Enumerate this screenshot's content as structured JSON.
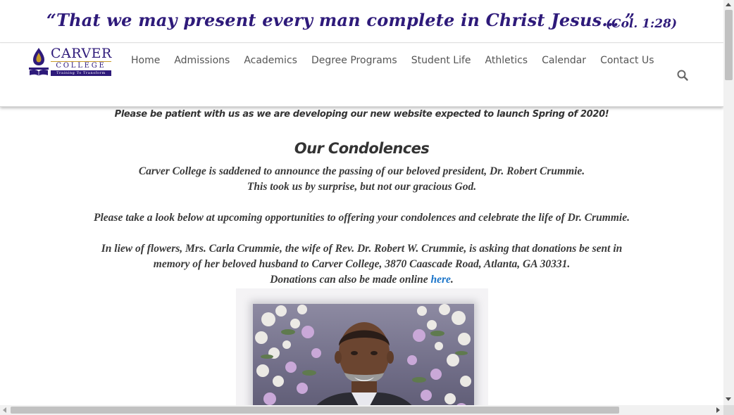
{
  "banner": {
    "quote": "“That we may present every man  complete in Christ Jesus… ”",
    "reference": "(Col. 1:28)"
  },
  "logo": {
    "name": "CARVER",
    "subtitle": "COLLEGE",
    "tagline": "Training To Transform"
  },
  "nav": {
    "items": [
      {
        "label": "Home"
      },
      {
        "label": "Admissions"
      },
      {
        "label": "Academics"
      },
      {
        "label": "Degree Programs"
      },
      {
        "label": "Student Life"
      },
      {
        "label": "Athletics"
      },
      {
        "label": "Calendar"
      },
      {
        "label": "Contact Us"
      }
    ],
    "search_icon": "search-icon"
  },
  "content": {
    "notice": "Please be patient with us as we are developing our new website expected to launch Spring of 2020!",
    "heading": "Our Condolences",
    "paragraph1_line1": "Carver College is saddened to announce the passing of our beloved president, Dr. Robert Crummie.",
    "paragraph1_line2": "This took us by surprise, but not our gracious God.",
    "paragraph2": "Please take a look below at upcoming opportunities to offering your condolences and celebrate the life of Dr. Crummie.",
    "paragraph3_line1": "In liew of flowers, Mrs. Carla Crummie, the wife of Rev. Dr. Robert W. Crummie, is asking that donations be sent in",
    "paragraph3_line2": "memory of her beloved husband to Carver College, 3870 Caascade Road, Atlanta, GA 30331.",
    "donations_text": "Donations can also be made online ",
    "donations_link": "here",
    "donations_end": "."
  },
  "colors": {
    "brand_purple": "#2e1a7a",
    "brand_gold": "#c79b28",
    "link_blue": "#1a74c9",
    "text_dark": "#333333"
  }
}
